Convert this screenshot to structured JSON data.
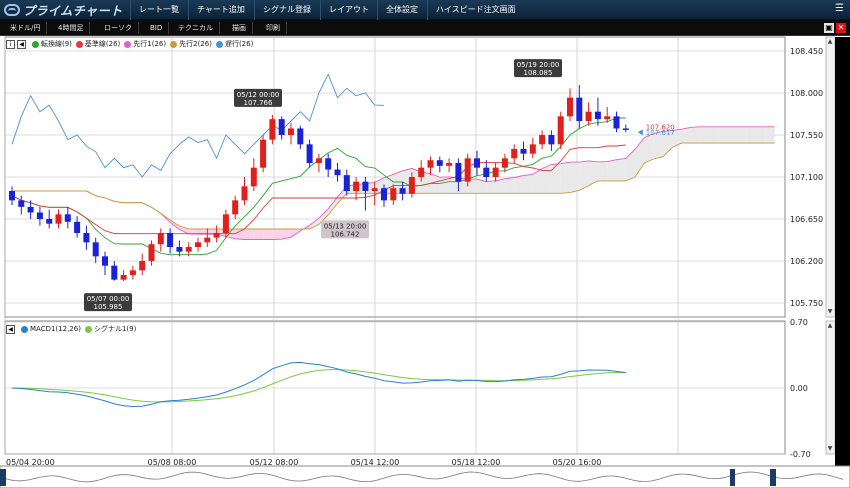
{
  "app": {
    "logo_text": "プライムチャート"
  },
  "menu": [
    {
      "label": "レート一覧"
    },
    {
      "label": "チャート追加"
    },
    {
      "label": "シグナル登録"
    },
    {
      "label": "レイアウト"
    },
    {
      "label": "全体設定"
    },
    {
      "label": "ハイスピード注文画面"
    }
  ],
  "toolbar": {
    "pair": "米ドル/円",
    "timeframe": "4時間足",
    "chart_type": "ローソク",
    "price_type": "BID",
    "technical": "テクニカル",
    "draw": "描画",
    "print": "印刷"
  },
  "legend_main": [
    {
      "label": "転換線(9)",
      "color": "#2da52d"
    },
    {
      "label": "基準線(26)",
      "color": "#e03a3a"
    },
    {
      "label": "先行1(26)",
      "color": "#e55fc8"
    },
    {
      "label": "先行2(26)",
      "color": "#c89b3a"
    },
    {
      "label": "遅行(26)",
      "color": "#4a90d9"
    }
  ],
  "legend_sub": [
    {
      "label": "MACD1(12,26)",
      "color": "#2a7fd4"
    },
    {
      "label": "シグナル1(9)",
      "color": "#7ac943"
    }
  ],
  "price_axis": [
    "108.450",
    "108.000",
    "107.550",
    "107.100",
    "106.650",
    "106.200",
    "105.750"
  ],
  "macd_axis": [
    "0.70",
    "0.00",
    "-0.70"
  ],
  "time_axis": [
    "05/04 20:00",
    "05/08 08:00",
    "05/12 08:00",
    "05/14 12:00",
    "05/18 12:00",
    "05/20 16:00"
  ],
  "callouts": [
    {
      "line1": "05/07 00:00",
      "line2": "105.985"
    },
    {
      "line1": "05/12 00:00",
      "line2": "107.766"
    },
    {
      "line1": "05/13 20:00",
      "line2": "106.742"
    },
    {
      "line1": "05/19 20:00",
      "line2": "108.085"
    }
  ],
  "price_tags": {
    "red": "107.620",
    "blue": "107.617"
  },
  "colors": {
    "bull": "#e0201c",
    "bear": "#1a22d8",
    "cloud_pink": "#fbd3e9",
    "cloud_gray": "#e9e9e9",
    "grid": "#bdbdbd",
    "header_bg": "#0b2238"
  },
  "chart_data": {
    "type": "candlestick",
    "ylim": [
      105.6,
      108.6
    ],
    "candles": [
      [
        106.95,
        106.85,
        107.0,
        106.8
      ],
      [
        106.85,
        106.78,
        106.9,
        106.7
      ],
      [
        106.78,
        106.72,
        106.85,
        106.65
      ],
      [
        106.72,
        106.65,
        106.78,
        106.58
      ],
      [
        106.65,
        106.6,
        106.75,
        106.55
      ],
      [
        106.6,
        106.7,
        106.75,
        106.55
      ],
      [
        106.7,
        106.62,
        106.78,
        106.55
      ],
      [
        106.62,
        106.5,
        106.68,
        106.45
      ],
      [
        106.5,
        106.4,
        106.58,
        106.32
      ],
      [
        106.4,
        106.25,
        106.45,
        106.18
      ],
      [
        106.25,
        106.15,
        106.3,
        106.05
      ],
      [
        106.15,
        106.0,
        106.2,
        105.99
      ],
      [
        106.0,
        106.05,
        106.1,
        105.985
      ],
      [
        106.05,
        106.1,
        106.15,
        106.0
      ],
      [
        106.1,
        106.2,
        106.28,
        106.05
      ],
      [
        106.2,
        106.38,
        106.42,
        106.15
      ],
      [
        106.38,
        106.5,
        106.55,
        106.3
      ],
      [
        106.5,
        106.35,
        106.55,
        106.28
      ],
      [
        106.35,
        106.3,
        106.42,
        106.25
      ],
      [
        106.3,
        106.35,
        106.4,
        106.25
      ],
      [
        106.35,
        106.4,
        106.45,
        106.3
      ],
      [
        106.4,
        106.45,
        106.55,
        106.35
      ],
      [
        106.45,
        106.5,
        106.58,
        106.4
      ],
      [
        106.5,
        106.7,
        106.75,
        106.45
      ],
      [
        106.7,
        106.85,
        106.9,
        106.65
      ],
      [
        106.85,
        107.0,
        107.1,
        106.8
      ],
      [
        107.0,
        107.2,
        107.3,
        106.95
      ],
      [
        107.2,
        107.5,
        107.55,
        107.15
      ],
      [
        107.5,
        107.72,
        107.766,
        107.45
      ],
      [
        107.72,
        107.55,
        107.75,
        107.5
      ],
      [
        107.55,
        107.62,
        107.68,
        107.45
      ],
      [
        107.62,
        107.45,
        107.65,
        107.4
      ],
      [
        107.45,
        107.25,
        107.5,
        107.2
      ],
      [
        107.25,
        107.3,
        107.35,
        107.15
      ],
      [
        107.3,
        107.18,
        107.35,
        107.1
      ],
      [
        107.18,
        107.12,
        107.25,
        107.05
      ],
      [
        107.12,
        106.95,
        107.18,
        106.9
      ],
      [
        106.95,
        107.05,
        107.1,
        106.85
      ],
      [
        107.05,
        106.95,
        107.1,
        106.742
      ],
      [
        106.95,
        106.98,
        107.05,
        106.8
      ],
      [
        106.98,
        106.85,
        107.02,
        106.78
      ],
      [
        106.85,
        106.98,
        107.02,
        106.8
      ],
      [
        106.98,
        106.92,
        107.05,
        106.85
      ],
      [
        106.92,
        107.1,
        107.15,
        106.88
      ],
      [
        107.1,
        107.2,
        107.28,
        107.05
      ],
      [
        107.2,
        107.28,
        107.32,
        107.12
      ],
      [
        107.28,
        107.22,
        107.32,
        107.15
      ],
      [
        107.22,
        107.25,
        107.3,
        107.15
      ],
      [
        107.25,
        107.05,
        107.3,
        106.95
      ],
      [
        107.05,
        107.3,
        107.35,
        107.0
      ],
      [
        107.3,
        107.2,
        107.38,
        107.12
      ],
      [
        107.2,
        107.1,
        107.28,
        107.05
      ],
      [
        107.1,
        107.2,
        107.25,
        107.05
      ],
      [
        107.2,
        107.3,
        107.35,
        107.15
      ],
      [
        107.3,
        107.4,
        107.45,
        107.25
      ],
      [
        107.4,
        107.35,
        107.48,
        107.28
      ],
      [
        107.35,
        107.45,
        107.52,
        107.3
      ],
      [
        107.45,
        107.55,
        107.6,
        107.4
      ],
      [
        107.55,
        107.45,
        107.6,
        107.38
      ],
      [
        107.45,
        107.75,
        107.8,
        107.4
      ],
      [
        107.75,
        107.95,
        108.05,
        107.7
      ],
      [
        107.95,
        107.7,
        108.085,
        107.62
      ],
      [
        107.7,
        107.8,
        107.9,
        107.65
      ],
      [
        107.8,
        107.72,
        107.95,
        107.65
      ],
      [
        107.72,
        107.75,
        107.85,
        107.68
      ],
      [
        107.75,
        107.62,
        107.8,
        107.58
      ],
      [
        107.62,
        107.617,
        107.66,
        107.58
      ]
    ]
  }
}
